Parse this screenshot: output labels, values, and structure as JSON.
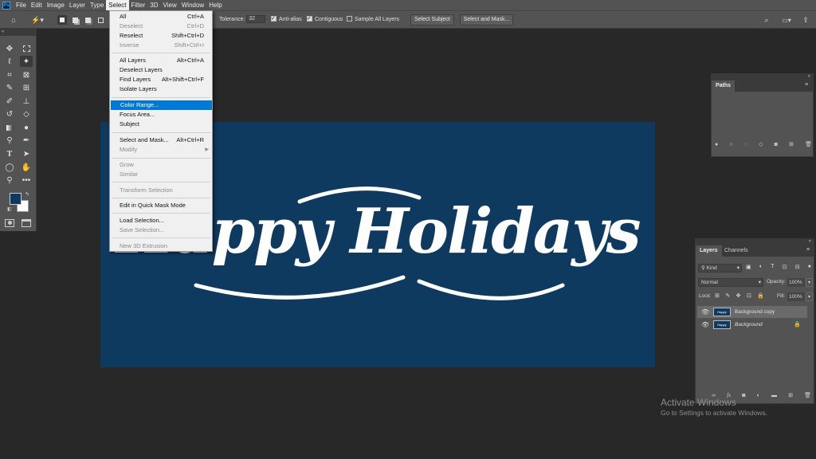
{
  "app": {
    "logo_text": "Ps"
  },
  "menubar": {
    "items": [
      "File",
      "Edit",
      "Image",
      "Layer",
      "Type",
      "Select",
      "Filter",
      "3D",
      "View",
      "Window",
      "Help"
    ],
    "active": "Select"
  },
  "optionsbar": {
    "tolerance_label": "Tolerance:",
    "tolerance_value": "32",
    "anti_alias_label": "Anti-alias",
    "contiguous_label": "Contiguous",
    "sample_all_label": "Sample All Layers",
    "select_subject_label": "Select Subject",
    "select_and_mask_label": "Select and Mask..."
  },
  "select_menu": {
    "items": [
      {
        "label": "All",
        "shortcut": "Ctrl+A",
        "disabled": false
      },
      {
        "label": "Deselect",
        "shortcut": "Ctrl+D",
        "disabled": true
      },
      {
        "label": "Reselect",
        "shortcut": "Shift+Ctrl+D",
        "disabled": false
      },
      {
        "label": "Inverse",
        "shortcut": "Shift+Ctrl+I",
        "disabled": true
      },
      {
        "label": "All Layers",
        "shortcut": "Alt+Ctrl+A",
        "disabled": false
      },
      {
        "label": "Deselect Layers",
        "shortcut": "",
        "disabled": false
      },
      {
        "label": "Find Layers",
        "shortcut": "Alt+Shift+Ctrl+F",
        "disabled": false
      },
      {
        "label": "Isolate Layers",
        "shortcut": "",
        "disabled": false
      },
      {
        "label": "Color Range...",
        "shortcut": "",
        "disabled": false,
        "highlighted": true
      },
      {
        "label": "Focus Area...",
        "shortcut": "",
        "disabled": false
      },
      {
        "label": "Subject",
        "shortcut": "",
        "disabled": false
      },
      {
        "label": "Select and Mask...",
        "shortcut": "Alt+Ctrl+R",
        "disabled": false
      },
      {
        "label": "Modify",
        "shortcut": "",
        "disabled": true,
        "submenu": true
      },
      {
        "label": "Grow",
        "shortcut": "",
        "disabled": true
      },
      {
        "label": "Similar",
        "shortcut": "",
        "disabled": true
      },
      {
        "label": "Transform Selection",
        "shortcut": "",
        "disabled": true
      },
      {
        "label": "Edit in Quick Mask Mode",
        "shortcut": "",
        "disabled": false
      },
      {
        "label": "Load Selection...",
        "shortcut": "",
        "disabled": false
      },
      {
        "label": "Save Selection...",
        "shortcut": "",
        "disabled": true
      },
      {
        "label": "New 3D Extrusion",
        "shortcut": "",
        "disabled": true
      }
    ]
  },
  "canvas": {
    "text": "Happy Holidays",
    "background": "#0e3a60",
    "text_color": "#ffffff"
  },
  "paths_panel": {
    "tab": "Paths"
  },
  "layers_panel": {
    "tabs": [
      "Layers",
      "Channels"
    ],
    "filter_label": "Kind",
    "blend_mode": "Normal",
    "opacity_label": "Opacity:",
    "opacity_value": "100%",
    "lock_label": "Lock:",
    "fill_label": "Fill:",
    "fill_value": "100%",
    "layers": [
      {
        "name": "Background copy",
        "selected": true,
        "locked": false
      },
      {
        "name": "Background",
        "selected": false,
        "locked": true
      }
    ]
  },
  "watermark": {
    "line1": "Activate Windows",
    "line2": "Go to Settings to activate Windows."
  },
  "colors": {
    "accent": "#0078d7",
    "foreground_swatch": "#0e3a60",
    "background_swatch": "#ffffff"
  }
}
